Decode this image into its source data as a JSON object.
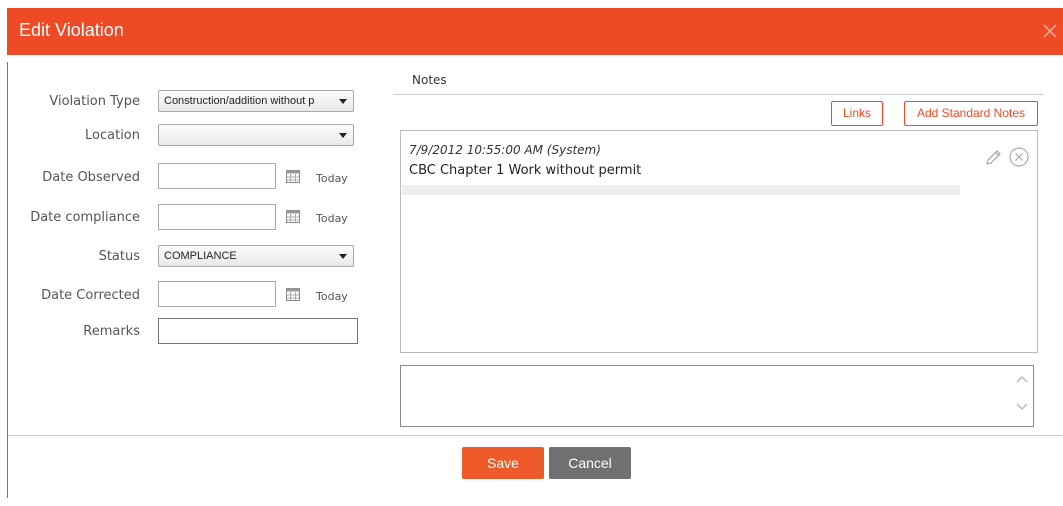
{
  "dialog": {
    "title": "Edit Violation",
    "accent_color": "#ef4a26",
    "close_icon": "close-icon"
  },
  "form": {
    "violation_type": {
      "label": "Violation Type",
      "value": "Construction/addition without p"
    },
    "location": {
      "label": "Location",
      "value": ""
    },
    "date_observed": {
      "label": "Date Observed",
      "value": "",
      "today_label": "Today"
    },
    "date_compliance": {
      "label": "Date compliance",
      "value": "",
      "today_label": "Today"
    },
    "status": {
      "label": "Status",
      "value": "COMPLIANCE"
    },
    "date_corrected": {
      "label": "Date Corrected",
      "value": "",
      "today_label": "Today"
    },
    "remarks": {
      "label": "Remarks",
      "value": ""
    }
  },
  "notes": {
    "header": "Notes",
    "links_label": "Links",
    "add_standard_label": "Add Standard Notes",
    "items": [
      {
        "meta": "7/9/2012 10:55:00 AM (System)",
        "text": "CBC Chapter 1 Work without permit"
      }
    ],
    "new_note_value": ""
  },
  "footer": {
    "save_label": "Save",
    "cancel_label": "Cancel",
    "save_color": "#ef5a2a",
    "cancel_color": "#707070"
  }
}
